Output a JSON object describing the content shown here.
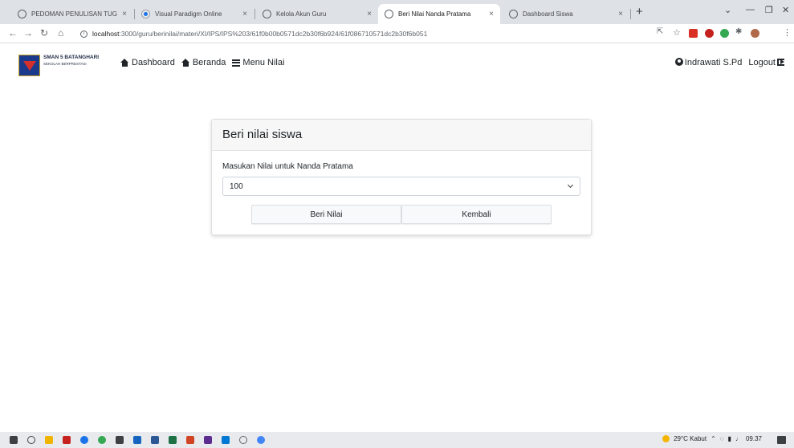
{
  "browser": {
    "tabs": [
      {
        "title": "PEDOMAN PENULISAN TUGAS A",
        "icon": "globe-icon",
        "active": false
      },
      {
        "title": "Visual Paradigm Online",
        "icon": "visual-paradigm-icon",
        "active": false
      },
      {
        "title": "Kelola Akun Guru",
        "icon": "globe-icon",
        "active": false
      },
      {
        "title": "Beri Nilai Nanda Pratama",
        "icon": "globe-icon",
        "active": true
      },
      {
        "title": "Dashboard Siswa",
        "icon": "globe-icon",
        "active": false
      }
    ],
    "tab_close_glyph": "×",
    "new_tab_glyph": "+",
    "url_host": "localhost",
    "url_rest": ":3000/guru/berinilai/materi/XI/IPS/IPS%203/61f0b00b0571dc2b30f6b924/61f086710571dc2b30f6b051"
  },
  "navbar": {
    "brand_name": "SMAN 5 BATANGHARI",
    "brand_tagline": "SEKOLAH BERPRESTASI",
    "links": [
      {
        "label": "Dashboard",
        "icon": "home-icon"
      },
      {
        "label": "Beranda",
        "icon": "home-icon"
      },
      {
        "label": "Menu Nilai",
        "icon": "menu-icon"
      }
    ],
    "user_name": "Indrawati S.Pd",
    "logout_label": "Logout"
  },
  "card": {
    "title": "Beri nilai siswa",
    "field_label": "Masukan Nilai untuk Nanda Pratama",
    "selected_value": "100",
    "submit_label": "Beri Nilai",
    "back_label": "Kembali"
  },
  "taskbar": {
    "weather": "29°C  Kabut",
    "time": "09.37"
  },
  "colors": {
    "tabstrip": "#dee1e6",
    "card_header_bg": "#f7f7f7",
    "button_bg": "#f8f9fa",
    "brand_blue": "#1b3a8c",
    "brand_red": "#d6302d"
  }
}
